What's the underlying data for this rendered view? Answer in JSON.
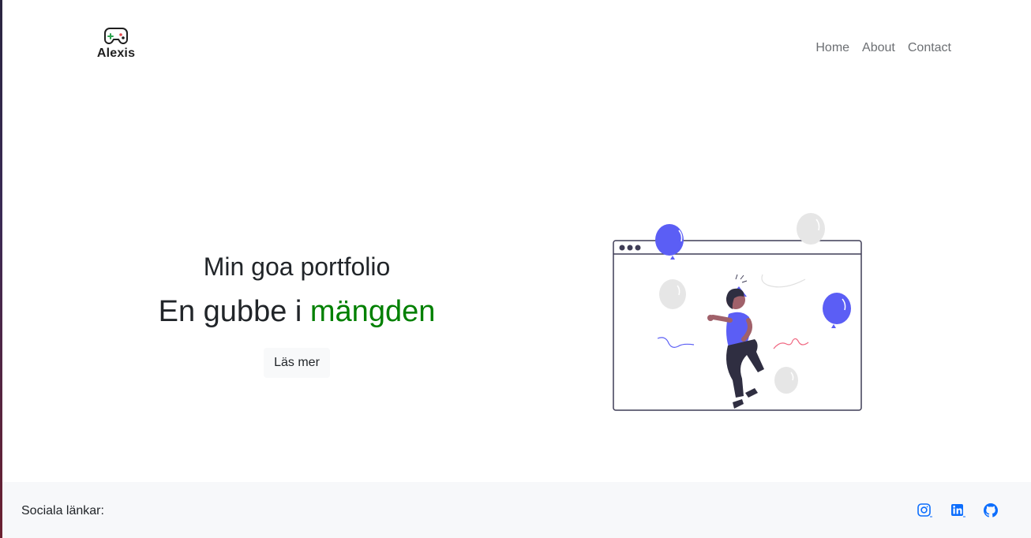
{
  "brand": {
    "name": "Alexis",
    "icon": "gamepad-icon"
  },
  "nav": {
    "items": [
      "Home",
      "About",
      "Contact"
    ]
  },
  "hero": {
    "title": "Min goa portfolio",
    "subtitle_prefix": "En gubbe i ",
    "subtitle_accent": "mängden",
    "button_label": "Läs mer"
  },
  "illustration": {
    "name": "party-celebration-illustration"
  },
  "footer": {
    "label": "Sociala länkar:",
    "links": [
      "instagram-icon",
      "linkedin-icon",
      "github-icon"
    ]
  },
  "colors": {
    "accent_green": "#008000",
    "social_blue": "#0d6efd",
    "balloon_blue": "#5b5ef5",
    "footer_bg": "#f7f8fa"
  }
}
